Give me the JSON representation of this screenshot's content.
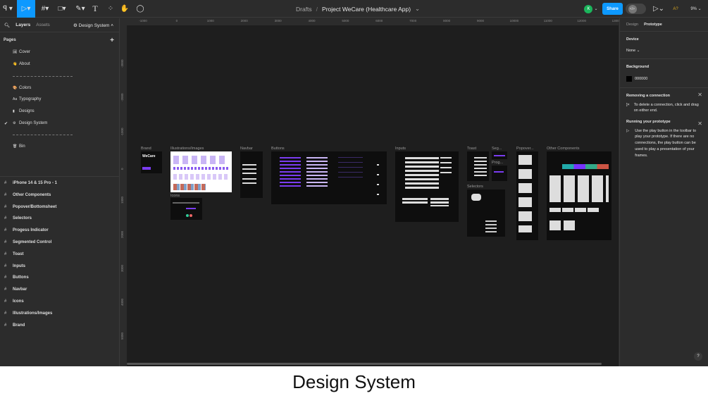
{
  "toolbar": {
    "breadcrumb_root": "Drafts",
    "separator": "/",
    "file_name": "Project WeCare (Healthcare App)",
    "avatar_initial": "K",
    "share_label": "Share",
    "ai_label": "A?",
    "zoom": "9%",
    "accent": "#0d99ff"
  },
  "left_panel": {
    "tab_layers": "Layers",
    "tab_assets": "Assets",
    "current_page": "Design System",
    "pages_heading": "Pages",
    "pages": [
      {
        "label": "Cover",
        "icon": "🖼"
      },
      {
        "label": "About",
        "icon": "👋"
      },
      {
        "label": "Colors",
        "icon": "🎨"
      },
      {
        "label": "Typography",
        "icon": "Aa"
      },
      {
        "label": "Designs",
        "icon": "▮"
      },
      {
        "label": "Design System",
        "icon": "⚙"
      },
      {
        "label": "Bin",
        "icon": "🗑"
      }
    ],
    "check": "✔",
    "layers": [
      "iPhone 14 & 15 Pro - 1",
      "Other Components",
      "Popover/Bottomsheet",
      "Selectors",
      "Progess Indicator",
      "Segmented Control",
      "Toast",
      "Inputs",
      "Buttons",
      "Navbar",
      "Icons",
      "Illustrations/Images",
      "Brand"
    ]
  },
  "rulers": {
    "h": [
      "-1000",
      "0",
      "1000",
      "2000",
      "3000",
      "4000",
      "5000",
      "6000",
      "7000",
      "8000",
      "9000",
      "10000",
      "11000",
      "12000",
      "1300"
    ],
    "v": [
      "-3000",
      "-2000",
      "-1000",
      "0",
      "1000",
      "2000",
      "3000",
      "4000",
      "5000",
      "6000"
    ]
  },
  "canvas": {
    "frames": {
      "brand": "Brand",
      "illustrations": "Illustrations/Images",
      "icons": "Icons",
      "navbar": "Navbar",
      "buttons": "Buttons",
      "inputs": "Inputs",
      "toast": "Toast",
      "seg": "Seg...",
      "prog": "Prog...",
      "selectors": "Selectors",
      "popover": "Popover...",
      "other": "Other Components"
    },
    "brand_logo": "WeCare"
  },
  "right_panel": {
    "tab_design": "Design",
    "tab_prototype": "Prototype",
    "device_heading": "Device",
    "device_value": "None",
    "background_heading": "Background",
    "background_hex": "000000",
    "background_color": "#000000",
    "tip1_title": "Removing a connection",
    "tip1_body": "To delete a connection, click and drag on either end.",
    "tip2_title": "Running your prototype",
    "tip2_body": "Use the play button in the toolbar to play your prototype. If there are no connections, the play button can be used to play a presentation of your frames.",
    "help": "?"
  },
  "caption": "Design System"
}
